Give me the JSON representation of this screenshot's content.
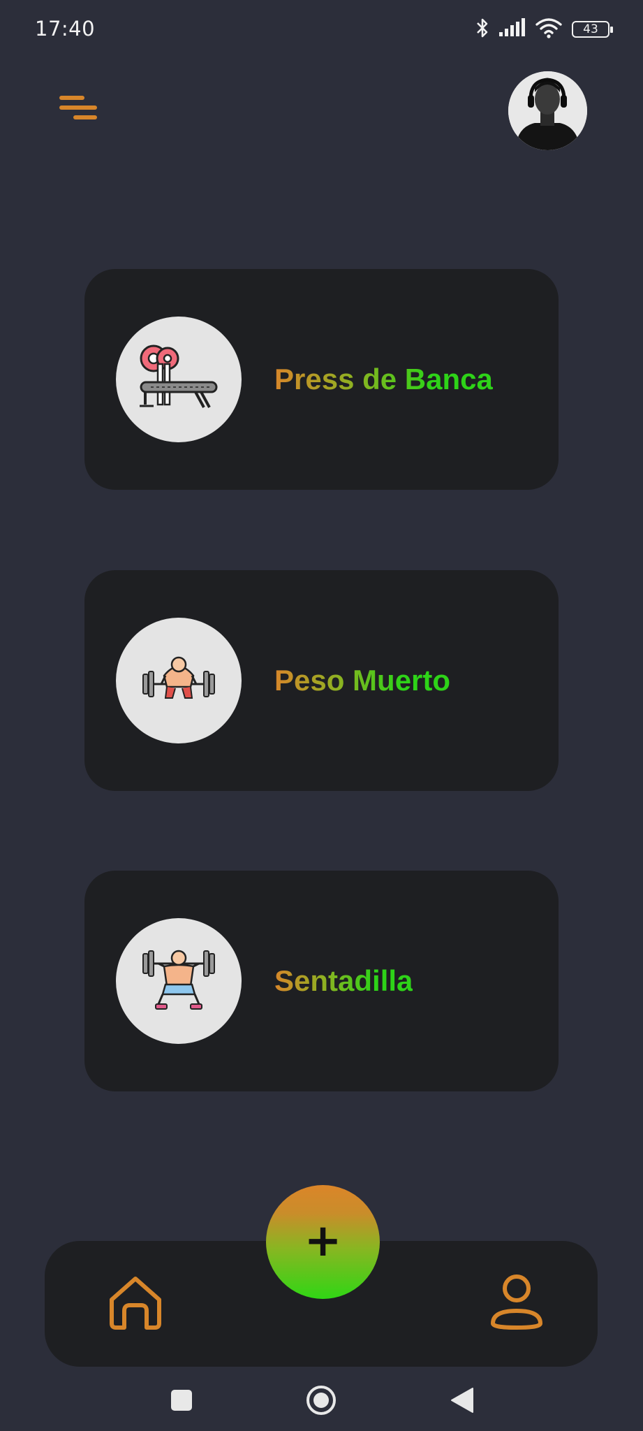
{
  "status_bar": {
    "time": "17:40",
    "battery_level": "43",
    "icons": [
      "bluetooth-icon",
      "signal-icon",
      "wifi-icon",
      "battery-icon"
    ]
  },
  "header": {
    "menu_icon": "menu-icon",
    "avatar_icon": "profile-avatar"
  },
  "exercises": [
    {
      "name": "Press de Banca",
      "icon": "bench-press-icon"
    },
    {
      "name": "Peso Muerto",
      "icon": "deadlift-icon"
    },
    {
      "name": "Sentadilla",
      "icon": "squat-icon"
    }
  ],
  "bottom_nav": {
    "home_icon": "home-icon",
    "add_symbol": "+",
    "profile_icon": "user-icon"
  },
  "system_nav": [
    "recents-icon",
    "home-circle-icon",
    "back-icon"
  ],
  "colors": {
    "background": "#2c2e3a",
    "card": "#1e1f22",
    "accent_orange": "#d8862a",
    "accent_green": "#2ed318",
    "icon_circle": "#e4e4e4"
  }
}
